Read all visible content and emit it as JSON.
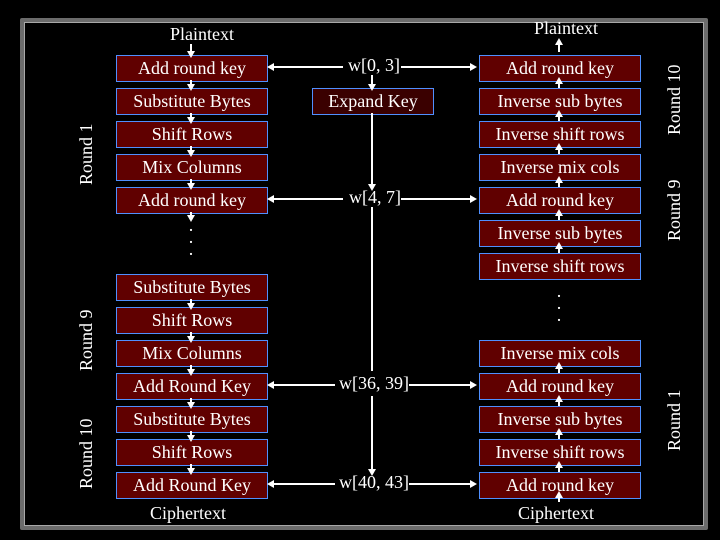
{
  "headers": {
    "left_plaintext": "Plaintext",
    "right_plaintext": "Plaintext"
  },
  "footers": {
    "left_ciphertext": "Ciphertext",
    "right_ciphertext": "Ciphertext"
  },
  "left": {
    "r1": {
      "add_key": "Add round key",
      "sub": "Substitute Bytes",
      "shift": "Shift Rows",
      "mix": "Mix Columns",
      "add_key2": "Add round key"
    },
    "r9": {
      "sub": "Substitute Bytes",
      "shift": "Shift Rows",
      "mix": "Mix Columns",
      "add_key": "Add Round Key"
    },
    "r10": {
      "sub": "Substitute Bytes",
      "shift": "Shift Rows",
      "add_key": "Add Round Key"
    }
  },
  "center": {
    "w0": "w[0, 3]",
    "expand": "Expand Key",
    "w4": "w[4, 7]",
    "w36": "w[36, 39]",
    "w40": "w[40, 43]"
  },
  "right": {
    "r10": {
      "add_key": "Add round key",
      "inv_sub": "Inverse sub bytes",
      "inv_shift": "Inverse shift rows"
    },
    "r9": {
      "inv_mix": "Inverse mix cols",
      "add_key": "Add round key",
      "inv_sub": "Inverse sub bytes",
      "inv_shift": "Inverse shift rows"
    },
    "r1": {
      "inv_mix": "Inverse mix cols",
      "add_key": "Add round key",
      "inv_sub": "Inverse sub bytes",
      "inv_shift": "Inverse shift rows",
      "add_key_last": "Add round key"
    }
  },
  "rounds": {
    "l1": "Round 1",
    "l9": "Round 9",
    "l10": "Round 10",
    "r1": "Round 1",
    "r9": "Round 9",
    "r10": "Round 10"
  }
}
